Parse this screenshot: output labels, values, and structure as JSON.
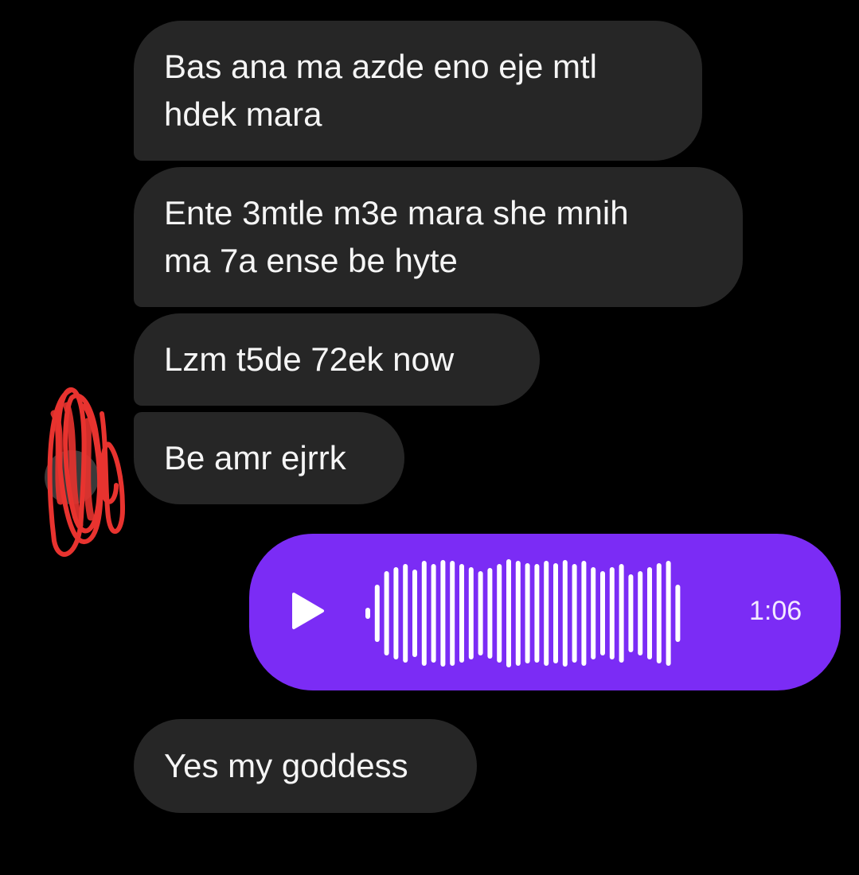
{
  "messages": {
    "m1": "Bas ana ma azde eno eje mtl\nhdek mara",
    "m2": "Ente 3mtle m3e mara she mnih\nma 7a ense be hyte",
    "m3": "Lzm t5de 72ek now",
    "m4": "Be amr ejrrk",
    "m5": "Yes my goddess"
  },
  "voice_note": {
    "duration": "1:06",
    "icon": "play-icon",
    "color": "#7b2cf5"
  },
  "colors": {
    "received_bubble": "#262626",
    "background": "#000000",
    "scribble": "#e8332f"
  }
}
